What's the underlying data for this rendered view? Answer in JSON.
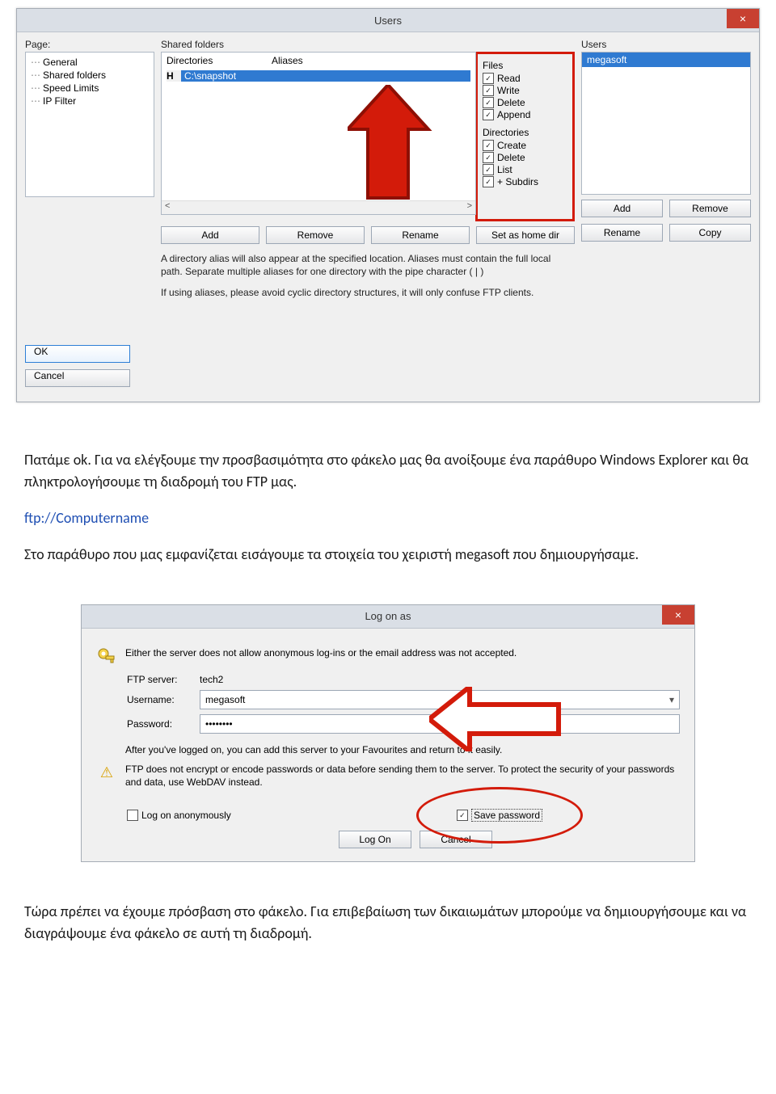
{
  "users_dialog": {
    "title": "Users",
    "close": "×",
    "page_label": "Page:",
    "tree": [
      "General",
      "Shared folders",
      "Speed Limits",
      "IP Filter"
    ],
    "shared_label": "Shared folders",
    "dir_header": {
      "col1": "Directories",
      "col2": "Aliases"
    },
    "dir_row": {
      "h": "H",
      "path": "C:\\snapshot"
    },
    "scroll": {
      "left": "<",
      "right": ">"
    },
    "files_label": "Files",
    "files_perms": [
      "Read",
      "Write",
      "Delete",
      "Append"
    ],
    "dirs_label": "Directories",
    "dirs_perms": [
      "Create",
      "Delete",
      "List",
      "+ Subdirs"
    ],
    "users_label": "Users",
    "users_list": [
      "megasoft"
    ],
    "buttons_dir": [
      "Add",
      "Remove",
      "Rename",
      "Set as home dir"
    ],
    "buttons_users": [
      "Add",
      "Remove",
      "Rename",
      "Copy"
    ],
    "desc1": "A directory alias will also appear at the specified location. Aliases must contain the full local path. Separate multiple aliases for one directory with the pipe character ( | )",
    "desc2": "If using aliases, please avoid cyclic directory structures, it will only confuse FTP clients.",
    "ok": "OK",
    "cancel": "Cancel"
  },
  "doc": {
    "p1": "Πατάμε ok. Για να ελέγξουμε την προσβασιμότητα στο φάκελο μας θα ανοίξουμε ένα παράθυρο Windows Explorer και θα πληκτρολογήσουμε τη  διαδρομή του FTP μας.",
    "p2": "ftp://Computername",
    "p3": "Στο παράθυρο που μας εμφανίζεται εισάγουμε τα στοιχεία του χειριστή megasoft που δημιουργήσαμε.",
    "p4": "Τώρα πρέπει να έχουμε πρόσβαση στο φάκελο. Για επιβεβαίωση των δικαιωμάτων μπορούμε να δημιουργήσουμε και να διαγράψουμε ένα φάκελο σε αυτή τη διαδρομή."
  },
  "logon_dialog": {
    "title": "Log on as",
    "close": "×",
    "msg1": "Either the server does not allow anonymous log-ins or the email address was not accepted.",
    "ftp_label": "FTP server:",
    "ftp_value": "tech2",
    "user_label": "Username:",
    "user_value": "megasoft",
    "pass_label": "Password:",
    "pass_value": "••••••••",
    "msg2": "After you've logged on, you can add this server to your Favourites and return to it easily.",
    "msg3": "FTP does not encrypt or encode passwords or data before sending them to the server. To protect the security of your passwords and data, use WebDAV instead.",
    "anon_label": "Log on anonymously",
    "save_label": "Save password",
    "logon_btn": "Log On",
    "cancel_btn": "Cancel"
  }
}
